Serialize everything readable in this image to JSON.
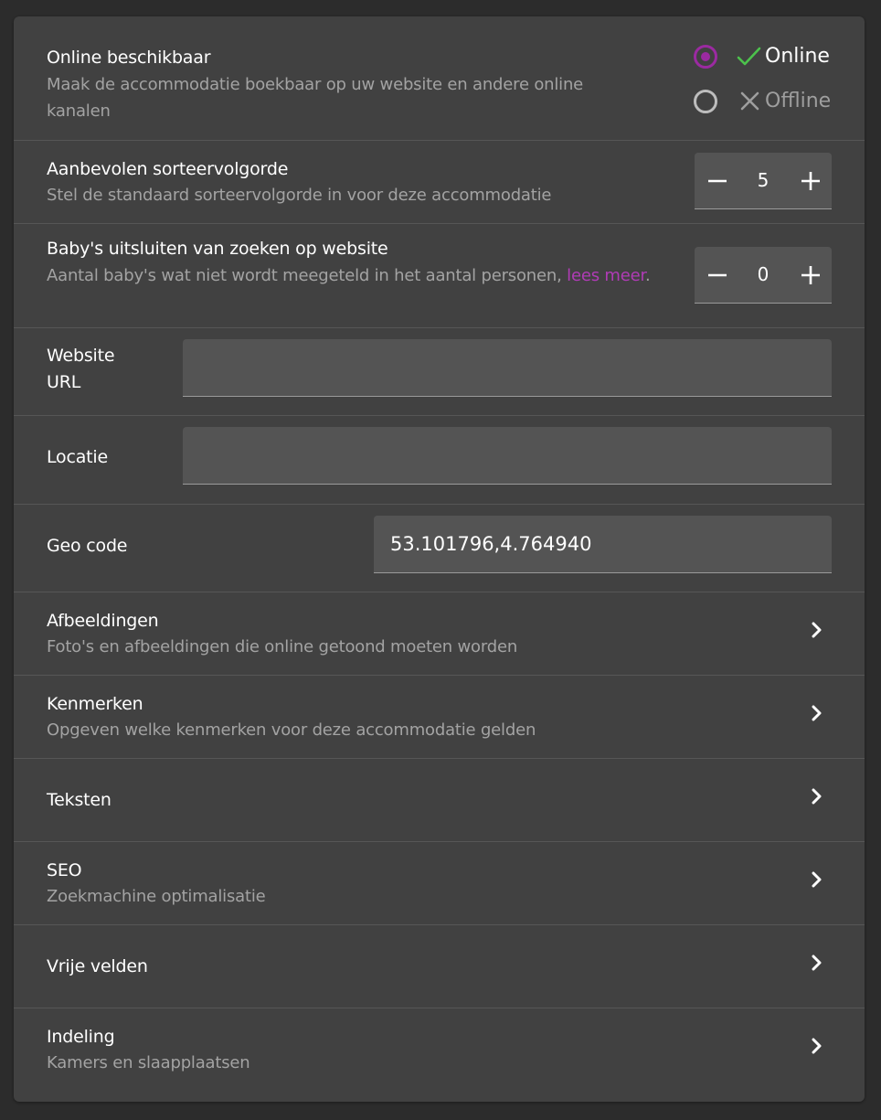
{
  "online": {
    "title": "Online beschikbaar",
    "desc": "Maak de accommodatie boekbaar op uw website en andere online kanalen",
    "option_online": "Online",
    "option_offline": "Offline",
    "selected": "Online",
    "accent_color": "#9b2aa1",
    "check_color": "#4cc24c"
  },
  "sort_order": {
    "title": "Aanbevolen sorteervolgorde",
    "desc": "Stel de standaard sorteervolgorde in voor deze accommodatie",
    "value": "5"
  },
  "babies": {
    "title": "Baby's uitsluiten van zoeken op website",
    "desc": "Aantal baby's wat niet wordt meegeteld in het aantal personen,",
    "link": "lees meer",
    "desc_end": ".",
    "value": "0"
  },
  "website_url": {
    "label": "Website URL",
    "value": ""
  },
  "locatie": {
    "label": "Locatie",
    "value": ""
  },
  "geo_code": {
    "label": "Geo code",
    "value": "53.101796,4.764940"
  },
  "nav": {
    "afbeeldingen": {
      "title": "Afbeeldingen",
      "desc": "Foto's en afbeeldingen die online getoond moeten worden"
    },
    "kenmerken": {
      "title": "Kenmerken",
      "desc": "Opgeven welke kenmerken voor deze accommodatie gelden"
    },
    "teksten": {
      "title": "Teksten"
    },
    "seo": {
      "title": "SEO",
      "desc": "Zoekmachine optimalisatie"
    },
    "vrije_velden": {
      "title": "Vrije velden"
    },
    "indeling": {
      "title": "Indeling",
      "desc": "Kamers en slaapplaatsen"
    }
  },
  "icons": {
    "chevron": "chevron-right-icon",
    "minus": "minus-icon",
    "plus": "plus-icon",
    "check": "check-icon",
    "close": "close-icon"
  }
}
